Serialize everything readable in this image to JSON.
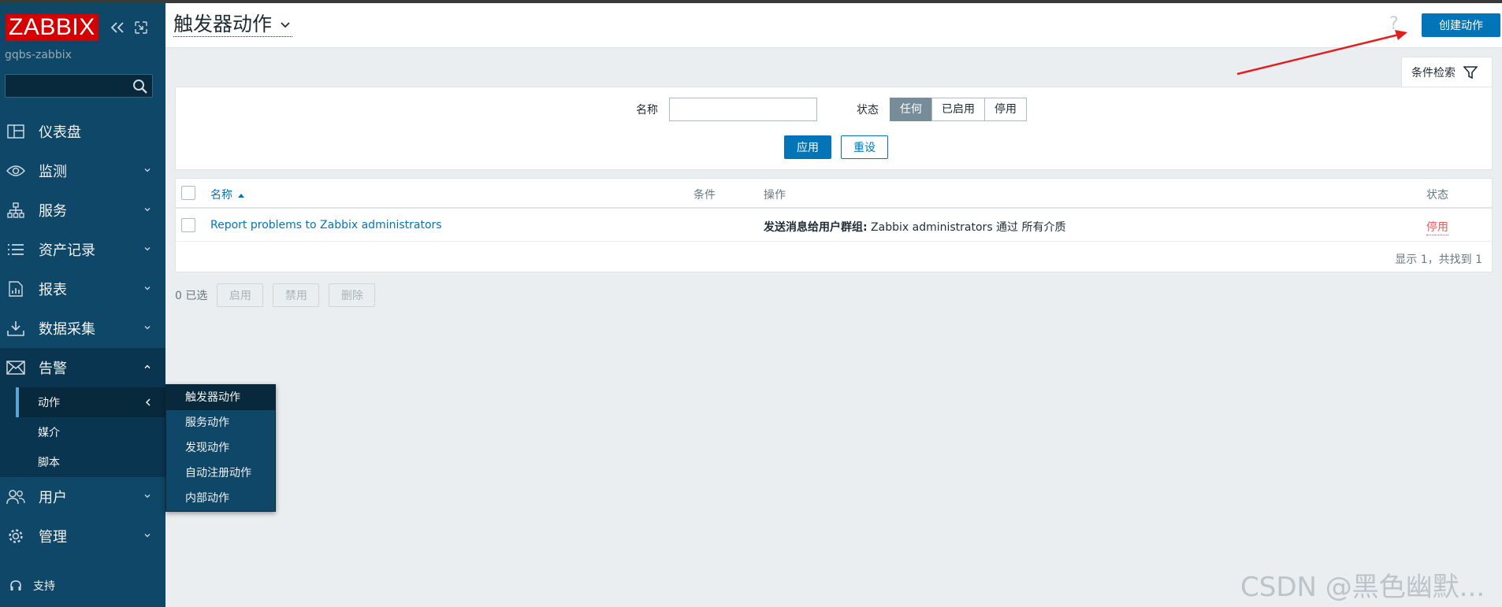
{
  "sidebar": {
    "logo": "ZABBIX",
    "server_name": "gqbs-zabbix",
    "search_placeholder": "",
    "items": [
      {
        "label": "仪表盘"
      },
      {
        "label": "监测"
      },
      {
        "label": "服务"
      },
      {
        "label": "资产记录"
      },
      {
        "label": "报表"
      },
      {
        "label": "数据采集"
      },
      {
        "label": "告警"
      },
      {
        "label": "用户"
      },
      {
        "label": "管理"
      }
    ],
    "alerts_sub": [
      {
        "label": "动作"
      },
      {
        "label": "媒介"
      },
      {
        "label": "脚本"
      }
    ],
    "support": "支持"
  },
  "flyout": [
    {
      "label": "触发器动作"
    },
    {
      "label": "服务动作"
    },
    {
      "label": "发现动作"
    },
    {
      "label": "自动注册动作"
    },
    {
      "label": "内部动作"
    }
  ],
  "header": {
    "title": "触发器动作",
    "help": "?",
    "create_button": "创建动作"
  },
  "filter": {
    "tab_label": "条件检索",
    "name_label": "名称",
    "name_value": "",
    "status_label": "状态",
    "status_options": [
      "任何",
      "已启用",
      "停用"
    ],
    "status_selected": "任何",
    "apply": "应用",
    "reset": "重设"
  },
  "table": {
    "headers": {
      "name": "名称",
      "conditions": "条件",
      "operations": "操作",
      "status": "状态"
    },
    "rows": [
      {
        "name": "Report problems to Zabbix administrators",
        "conditions": "",
        "operation_prefix": "发送消息给用户群组:",
        "operation_text": " Zabbix administrators 通过 所有介质",
        "status": "停用"
      }
    ],
    "summary": "显示 1，共找到 1"
  },
  "bulk": {
    "selected": "0 已选",
    "enable": "启用",
    "disable": "禁用",
    "delete": "删除"
  },
  "watermark": "CSDN @黑色幽默..."
}
